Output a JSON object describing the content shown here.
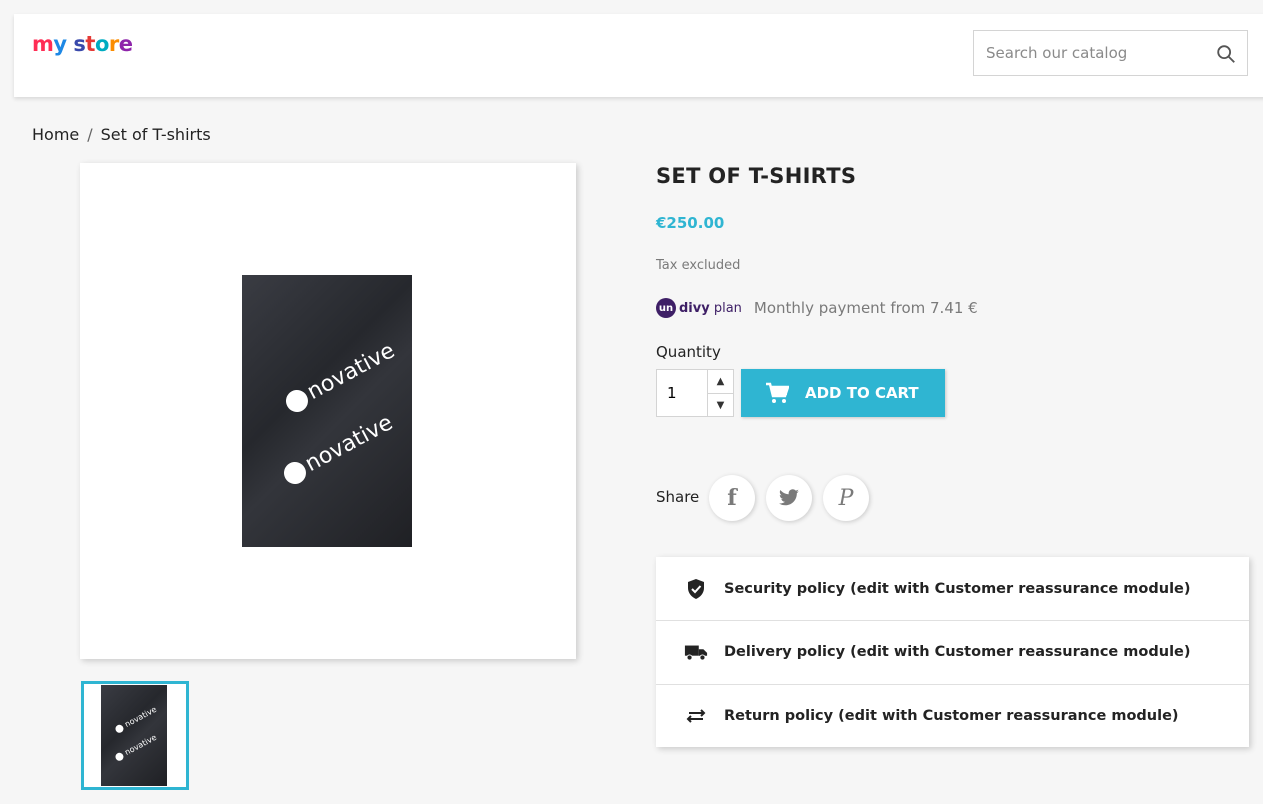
{
  "header": {
    "logo": {
      "word1": "my",
      "word2": "store"
    },
    "search": {
      "placeholder": "Search our catalog",
      "icon": "search-icon"
    }
  },
  "breadcrumb": {
    "items": [
      "Home",
      "Set of T-shirts"
    ],
    "separator": "/"
  },
  "product": {
    "title": "SET OF T-SHIRTS",
    "price": "€250.00",
    "tax_note": "Tax excluded",
    "installments": {
      "icon_letters": "un",
      "brand_bold": "divy",
      "brand_light": " plan",
      "text": "Monthly payment from 7.41 €"
    },
    "quantity_label": "Quantity",
    "quantity_value": "1",
    "add_to_cart": "ADD TO CART",
    "image_brand_text": "novative",
    "share_label": "Share",
    "social": [
      {
        "name": "facebook",
        "glyph": "f"
      },
      {
        "name": "twitter",
        "glyph": "🐦"
      },
      {
        "name": "pinterest",
        "glyph": "P"
      }
    ]
  },
  "reassurance": [
    {
      "icon": "shield-icon",
      "text": "Security policy (edit with Customer reassurance module)"
    },
    {
      "icon": "truck-icon",
      "text": "Delivery policy (edit with Customer reassurance module)"
    },
    {
      "icon": "swap-arrows-icon",
      "text": "Return policy (edit with Customer reassurance module)"
    }
  ],
  "colors": {
    "accent": "#2fb5d2",
    "divy": "#3e1f66",
    "background": "#f6f6f6"
  }
}
